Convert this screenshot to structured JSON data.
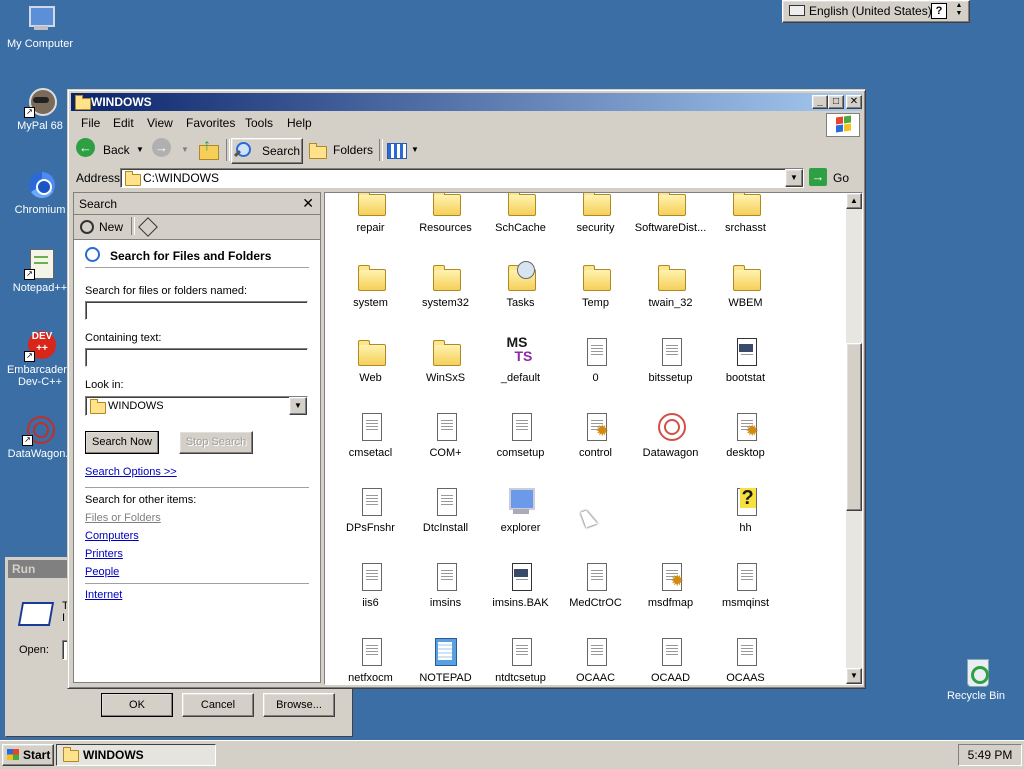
{
  "desktop_icons": [
    {
      "label": "My Computer",
      "icon": "my-computer-icon"
    },
    {
      "label": "MyPal 68",
      "icon": "mypal-icon"
    },
    {
      "label": "Chromium",
      "icon": "chromium-icon"
    },
    {
      "label": "Notepad++",
      "icon": "notepadpp-icon"
    },
    {
      "label": "Embarcadero Dev-C++",
      "icon": "devcpp-icon"
    },
    {
      "label": "DataWagon.",
      "icon": "datawagon-icon"
    },
    {
      "label": "Recycle Bin",
      "icon": "recycle-bin-icon"
    }
  ],
  "langbar": {
    "language": "English (United States)",
    "help": "?"
  },
  "run_dialog": {
    "title": "Run",
    "text_partial": "T\nI",
    "open_label": "Open:",
    "ok": "OK",
    "cancel": "Cancel",
    "browse": "Browse..."
  },
  "window": {
    "title": "WINDOWS",
    "menu": [
      "File",
      "Edit",
      "View",
      "Favorites",
      "Tools",
      "Help"
    ],
    "toolbar": {
      "back": "Back",
      "search": "Search",
      "folders": "Folders"
    },
    "address": {
      "label": "Address",
      "value": "C:\\WINDOWS",
      "go": "Go"
    }
  },
  "search_pane": {
    "header": "Search",
    "new_label": "New",
    "heading": "Search for Files and Folders",
    "named_label": "Search for files or folders named:",
    "named_value": "",
    "containing_label": "Containing text:",
    "containing_value": "",
    "lookin_label": "Look in:",
    "lookin_value": "WINDOWS",
    "search_now": "Search Now",
    "stop_search": "Stop Search",
    "options_link": "Search Options >>",
    "other_label": "Search for other items:",
    "other_items": [
      "Files or Folders",
      "Computers",
      "Printers",
      "People"
    ],
    "internet": "Internet"
  },
  "files": [
    [
      {
        "name": "repair",
        "type": "folder"
      },
      {
        "name": "Resources",
        "type": "folder"
      },
      {
        "name": "SchCache",
        "type": "folder"
      },
      {
        "name": "security",
        "type": "folder"
      },
      {
        "name": "SoftwareDist...",
        "type": "folder"
      },
      {
        "name": "srchasst",
        "type": "folder"
      }
    ],
    [
      {
        "name": "system",
        "type": "folder"
      },
      {
        "name": "system32",
        "type": "folder"
      },
      {
        "name": "Tasks",
        "type": "folder"
      },
      {
        "name": "Temp",
        "type": "folder"
      },
      {
        "name": "twain_32",
        "type": "folder"
      },
      {
        "name": "WBEM",
        "type": "folder"
      }
    ],
    [
      {
        "name": "Web",
        "type": "folder"
      },
      {
        "name": "WinSxS",
        "type": "folder"
      },
      {
        "name": "_default",
        "type": "msts"
      },
      {
        "name": "0",
        "type": "doc"
      },
      {
        "name": "bitssetup",
        "type": "doc"
      },
      {
        "name": "bootstat",
        "type": "dat"
      }
    ],
    [
      {
        "name": "cmsetacl",
        "type": "doc"
      },
      {
        "name": "COM+",
        "type": "doc"
      },
      {
        "name": "comsetup",
        "type": "doc"
      },
      {
        "name": "control",
        "type": "config"
      },
      {
        "name": "Datawagon",
        "type": "datawagon"
      },
      {
        "name": "desktop",
        "type": "config"
      }
    ],
    [
      {
        "name": "DPsFnshr",
        "type": "doc"
      },
      {
        "name": "DtcInstall",
        "type": "doc"
      },
      {
        "name": "explorer",
        "type": "explorer"
      },
      {
        "name": "",
        "type": "none"
      },
      {
        "name": "",
        "type": "none"
      },
      {
        "name": "hh",
        "type": "help"
      }
    ],
    [
      {
        "name": "iis6",
        "type": "doc"
      },
      {
        "name": "imsins",
        "type": "doc"
      },
      {
        "name": "imsins.BAK",
        "type": "dat"
      },
      {
        "name": "MedCtrOC",
        "type": "doc"
      },
      {
        "name": "msdfmap",
        "type": "config"
      },
      {
        "name": "msmqinst",
        "type": "doc"
      }
    ],
    [
      {
        "name": "netfxocm",
        "type": "doc"
      },
      {
        "name": "NOTEPAD",
        "type": "notepad"
      },
      {
        "name": "ntdtcsetup",
        "type": "doc"
      },
      {
        "name": "OCAAC",
        "type": "doc"
      },
      {
        "name": "OCAAD",
        "type": "doc"
      },
      {
        "name": "OCAAS",
        "type": "doc"
      }
    ]
  ],
  "taskbar": {
    "start": "Start",
    "task": "WINDOWS",
    "clock": "5:49 PM"
  }
}
